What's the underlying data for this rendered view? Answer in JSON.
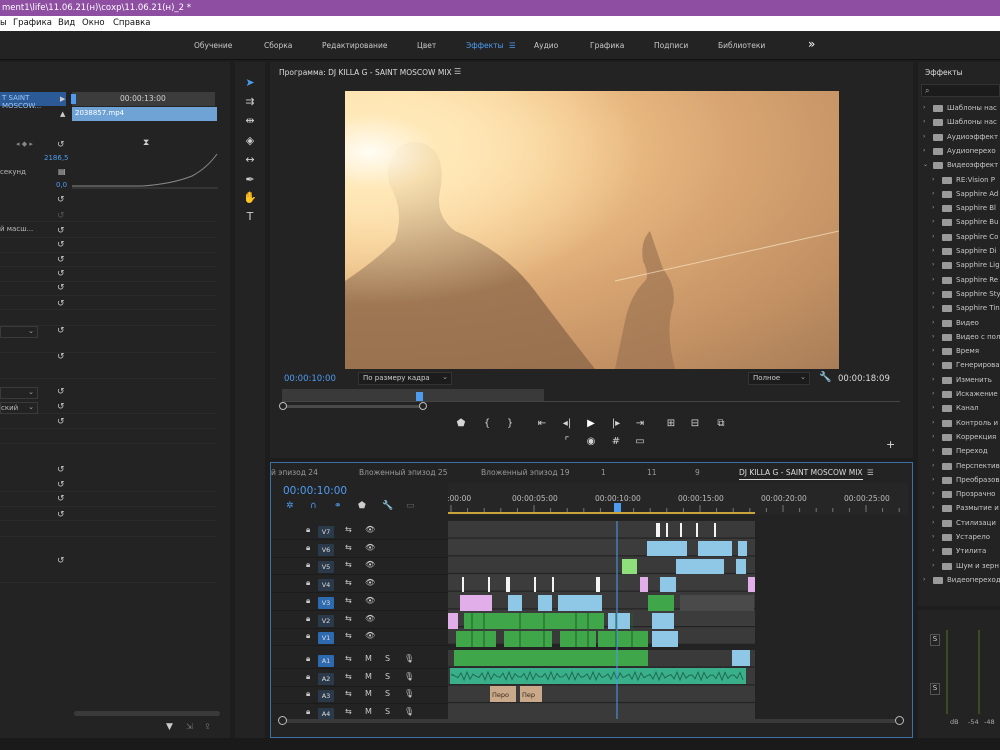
{
  "window": {
    "title": "ment1\\life\\11.06.21(н)\\сохр\\11.06.21(н)_2 *"
  },
  "menu": [
    "ы",
    "Графика",
    "Вид",
    "Окно",
    "Справка"
  ],
  "workspaces": [
    "Обучение",
    "Сборка",
    "Редактирование",
    "Цвет",
    "Эффекты",
    "Аудио",
    "Графика",
    "Подписи",
    "Библиотеки"
  ],
  "workspaces_active": "Эффекты",
  "effect_controls": {
    "sequence_label": "T SAINT MOSCOW...",
    "timecode": "00:00:13:00",
    "clip_name": "2038857.mp4",
    "value_1": "2186,5",
    "label_seconds": "секунд",
    "value_2": "0,0",
    "label_scale": "й масш...",
    "label_lang": "ский"
  },
  "program": {
    "title": "Программа: DJ KILLA G - SAINT MOSCOW MIX",
    "current_time": "00:00:10:00",
    "fit_label": "По размеру кадра",
    "quality_label": "Полное",
    "duration": "00:00:18:09"
  },
  "timeline": {
    "tabs": [
      "й эпизод 24",
      "Вложенный эпизод 25",
      "Вложенный эпизод 19",
      "1",
      "11",
      "9",
      "DJ KILLA G - SAINT MOSCOW MIX"
    ],
    "current_time": "00:00:10:00",
    "ruler": [
      ":00:00",
      "00:00:05:00",
      "00:00:10:00",
      "00:00:15:00",
      "00:00:20:00",
      "00:00:25:00"
    ],
    "video_tracks": [
      "V7",
      "V6",
      "V5",
      "V4",
      "V3",
      "V2",
      "V1"
    ],
    "audio_tracks": [
      "A1",
      "A2",
      "A3",
      "A4"
    ],
    "clip_labels": [
      "Перо",
      "Пер"
    ],
    "mute_label": "M",
    "solo_label": "S"
  },
  "effects": {
    "title": "Эффекты",
    "items": [
      {
        "label": "Шаблоны нас",
        "level": 0,
        "icon": "preset-folder"
      },
      {
        "label": "Шаблоны нас",
        "level": 0,
        "icon": "preset-folder"
      },
      {
        "label": "Аудиоэффект",
        "level": 0,
        "icon": "folder"
      },
      {
        "label": "Аудиоперехо",
        "level": 0,
        "icon": "folder"
      },
      {
        "label": "Видеоэффект",
        "level": 0,
        "icon": "folder",
        "open": true
      },
      {
        "label": "RE:Vision P",
        "level": 1,
        "icon": "folder"
      },
      {
        "label": "Sapphire Ad",
        "level": 1,
        "icon": "folder"
      },
      {
        "label": "Sapphire Bl",
        "level": 1,
        "icon": "folder"
      },
      {
        "label": "Sapphire Bu",
        "level": 1,
        "icon": "folder"
      },
      {
        "label": "Sapphire Co",
        "level": 1,
        "icon": "folder"
      },
      {
        "label": "Sapphire Di",
        "level": 1,
        "icon": "folder"
      },
      {
        "label": "Sapphire Lig",
        "level": 1,
        "icon": "folder"
      },
      {
        "label": "Sapphire Re",
        "level": 1,
        "icon": "folder"
      },
      {
        "label": "Sapphire Sty",
        "level": 1,
        "icon": "folder"
      },
      {
        "label": "Sapphire Tin",
        "level": 1,
        "icon": "folder"
      },
      {
        "label": "Видео",
        "level": 1,
        "icon": "folder"
      },
      {
        "label": "Видео с пол",
        "level": 1,
        "icon": "folder"
      },
      {
        "label": "Время",
        "level": 1,
        "icon": "folder"
      },
      {
        "label": "Генерирова",
        "level": 1,
        "icon": "folder"
      },
      {
        "label": "Изменить",
        "level": 1,
        "icon": "folder"
      },
      {
        "label": "Искажение",
        "level": 1,
        "icon": "folder"
      },
      {
        "label": "Канал",
        "level": 1,
        "icon": "folder"
      },
      {
        "label": "Контроль и",
        "level": 1,
        "icon": "folder"
      },
      {
        "label": "Коррекция",
        "level": 1,
        "icon": "folder"
      },
      {
        "label": "Переход",
        "level": 1,
        "icon": "folder"
      },
      {
        "label": "Перспектив",
        "level": 1,
        "icon": "folder"
      },
      {
        "label": "Преобразов",
        "level": 1,
        "icon": "folder"
      },
      {
        "label": "Прозрачно",
        "level": 1,
        "icon": "folder"
      },
      {
        "label": "Размытие и",
        "level": 1,
        "icon": "folder"
      },
      {
        "label": "Стилизаци",
        "level": 1,
        "icon": "folder"
      },
      {
        "label": "Устарело",
        "level": 1,
        "icon": "folder"
      },
      {
        "label": "Утилита",
        "level": 1,
        "icon": "folder"
      },
      {
        "label": "Шум и зерн",
        "level": 1,
        "icon": "folder"
      },
      {
        "label": "Видеопереход",
        "level": 0,
        "icon": "folder"
      }
    ]
  },
  "audio_meter": {
    "solo_label": "S",
    "scale": [
      "dB",
      "-54",
      "-48"
    ]
  },
  "colors": {
    "titlebar": "#8e4fa3",
    "accent": "#4d9cf0",
    "clip_green": "#3fa64a",
    "clip_blue": "#8fc8e6",
    "clip_pink": "#e1aeea",
    "audio_green": "#3ab08a",
    "playhead": "#4d9cf0"
  }
}
